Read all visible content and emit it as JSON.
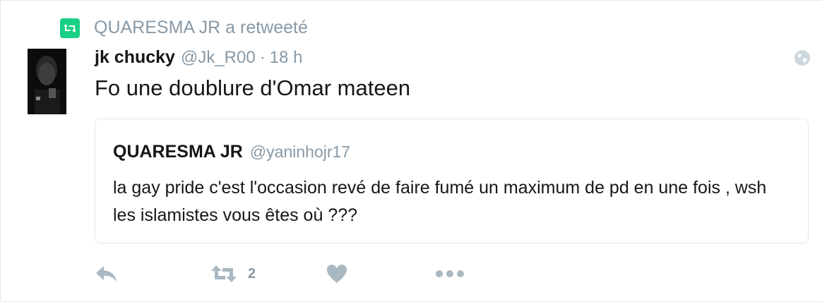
{
  "context": {
    "retweeter_text": "QUARESMA JR a retweeté",
    "icon": "retweet-icon"
  },
  "tweet": {
    "author_name": "jk chucky",
    "author_handle": "@Jk_R00",
    "separator": "·",
    "time": "18 h",
    "text": "Fo une doublure d'Omar mateen",
    "globe_icon": "globe-icon"
  },
  "quoted": {
    "author_name": "QUARESMA JR",
    "author_handle": "@yaninhojr17",
    "text": "la gay pride c'est l'occasion revé de faire fumé un maximum de pd en une fois , wsh les islamistes vous êtes où ???"
  },
  "actions": {
    "reply_icon": "reply-icon",
    "retweet_icon": "retweet-icon",
    "retweet_count": "2",
    "like_icon": "heart-icon",
    "more_icon": "more-icon"
  },
  "colors": {
    "retweet_green": "#19cf86",
    "secondary_text": "#8899a6",
    "primary_text": "#14171a",
    "icon_gray": "#aab8c2",
    "border": "#e1e8ed"
  }
}
